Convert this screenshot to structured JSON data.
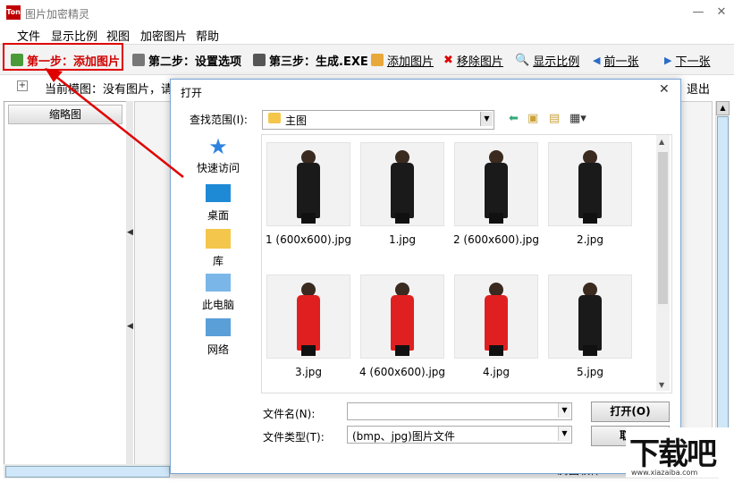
{
  "window": {
    "title": "图片加密精灵",
    "icon_text": "Ton",
    "minimize": "—",
    "close": "✕"
  },
  "menu": [
    "文件",
    "显示比例",
    "视图",
    "加密图片",
    "帮助"
  ],
  "toolbar": {
    "step1": "第一步：添加图片",
    "step2": "第二步：设置选项",
    "step3": "第三步：生成.EXE",
    "add": "添加图片",
    "remove": "移除图片",
    "zoom": "显示比例",
    "prev": "前一张",
    "next": "下一张"
  },
  "status": {
    "current": "当前模图：没有图片，请点",
    "exit": "退出",
    "expand": "+"
  },
  "left_panel": {
    "header": "缩略图"
  },
  "statusbar": {
    "text": "腾图软件 -"
  },
  "dialog": {
    "title": "打开",
    "close": "✕",
    "look_in_label": "查找范围(I):",
    "look_in_value": "主图",
    "places": [
      {
        "label": "快速访问",
        "icon": "star-icon"
      },
      {
        "label": "桌面",
        "icon": "desktop-icon"
      },
      {
        "label": "库",
        "icon": "library-icon"
      },
      {
        "label": "此电脑",
        "icon": "computer-icon"
      },
      {
        "label": "网络",
        "icon": "network-icon"
      }
    ],
    "files": [
      {
        "name": "1 (600x600).jpg",
        "dress": "#1a1a1a"
      },
      {
        "name": "1.jpg",
        "dress": "#1a1a1a"
      },
      {
        "name": "2 (600x600).jpg",
        "dress": "#1a1a1a"
      },
      {
        "name": "2.jpg",
        "dress": "#1a1a1a"
      },
      {
        "name": "3.jpg",
        "dress": "#e02020"
      },
      {
        "name": "4 (600x600).jpg",
        "dress": "#e02020"
      },
      {
        "name": "4.jpg",
        "dress": "#e02020"
      },
      {
        "name": "5.jpg",
        "dress": "#1a1a1a"
      }
    ],
    "filename_label": "文件名(N):",
    "filename_value": "",
    "filetype_label": "文件类型(T):",
    "filetype_value": "(bmp、jpg)图片文件",
    "open_button": "打开(O)",
    "cancel_button": "取消"
  },
  "watermark": {
    "text": "下载吧",
    "url": "www.xiazaiba.com"
  },
  "colors": {
    "highlight_red": "#e00000",
    "step1_text": "#d00000"
  }
}
